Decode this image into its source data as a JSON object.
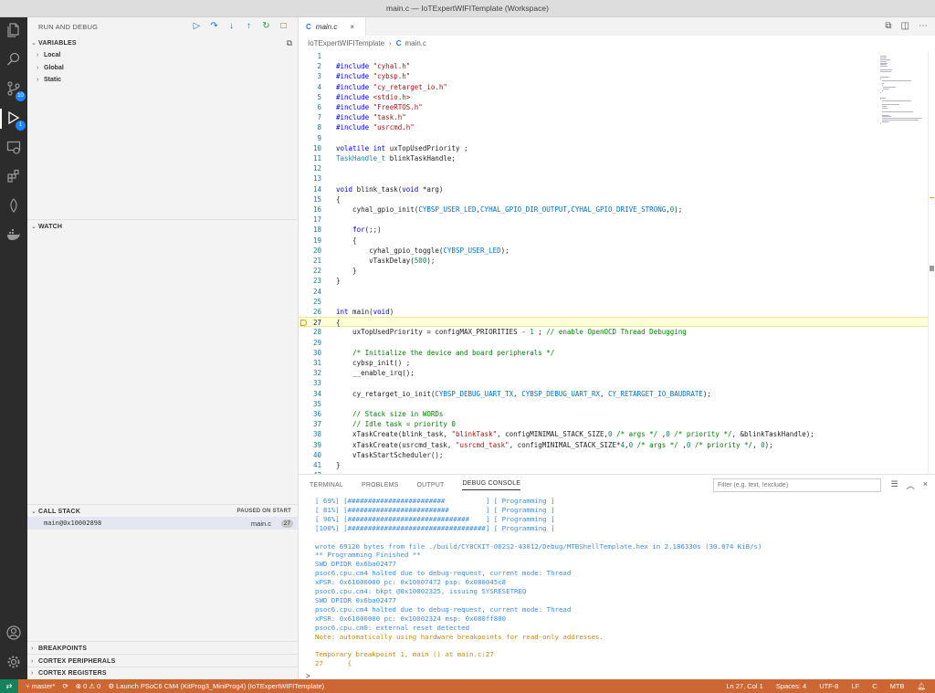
{
  "window": {
    "title": "main.c — IoTExpertWIFITemplate (Workspace)"
  },
  "activity_bar": {
    "items": [
      {
        "icon": "files-icon"
      },
      {
        "icon": "search-icon"
      },
      {
        "icon": "source-control-icon",
        "badge": "10"
      },
      {
        "icon": "run-debug-icon",
        "badge": "1"
      },
      {
        "icon": "remote-explorer-icon"
      },
      {
        "icon": "extensions-icon"
      },
      {
        "icon": "leaf-icon"
      },
      {
        "icon": "docker-icon"
      }
    ],
    "account_icon": "account-icon",
    "settings_icon": "gear-icon"
  },
  "sidebar": {
    "title": "RUN AND DEBUG",
    "toolbar": [
      "continue-icon",
      "step-over-icon",
      "step-into-icon",
      "step-out-icon",
      "restart-icon",
      "stop-icon"
    ],
    "variables": {
      "title": "VARIABLES",
      "items": [
        "Local",
        "Global",
        "Static"
      ]
    },
    "watch": {
      "title": "WATCH"
    },
    "call_stack": {
      "title": "CALL STACK",
      "status": "PAUSED ON START",
      "frame": "main@0x10002898",
      "file": "main.c",
      "line": "27"
    },
    "breakpoints": {
      "title": "BREAKPOINTS"
    },
    "cortex_peripherals": {
      "title": "CORTEX PERIPHERALS"
    },
    "cortex_registers": {
      "title": "CORTEX REGISTERS"
    }
  },
  "editor": {
    "tab": {
      "label": "main.c"
    },
    "breadcrumb": {
      "folder": "IoTExpertWIFITemplate",
      "file": "main.c"
    },
    "current_line": 27,
    "lines": [
      "",
      "#include \"cyhal.h\"",
      "#include \"cybsp.h\"",
      "#include \"cy_retarget_io.h\"",
      "#include <stdio.h>",
      "#include \"FreeRTOS.h\"",
      "#include \"task.h\"",
      "#include \"usrcmd.h\"",
      "",
      "volatile int uxTopUsedPriority ;",
      "TaskHandle_t blinkTaskHandle;",
      "",
      "",
      "void blink_task(void *arg)",
      "{",
      "    cyhal_gpio_init(CYBSP_USER_LED,CYHAL_GPIO_DIR_OUTPUT,CYHAL_GPIO_DRIVE_STRONG,0);",
      "",
      "    for(;;)",
      "    {",
      "        cyhal_gpio_toggle(CYBSP_USER_LED);",
      "        vTaskDelay(500);",
      "    }",
      "}",
      "",
      "",
      "int main(void)",
      "{",
      "    uxTopUsedPriority = configMAX_PRIORITIES - 1 ; // enable OpenOCD Thread Debugging",
      "",
      "    /* Initialize the device and board peripherals */",
      "    cybsp_init() ;",
      "    __enable_irq();",
      "",
      "    cy_retarget_io_init(CYBSP_DEBUG_UART_TX, CYBSP_DEBUG_UART_RX, CY_RETARGET_IO_BAUDRATE);",
      "",
      "    // Stack size in WORDs",
      "    // Idle task = priority 0",
      "    xTaskCreate(blink_task, \"blinkTask\", configMINIMAL_STACK_SIZE,0 /* args */ ,0 /* priority */, &blinkTaskHandle);",
      "    xTaskCreate(usrcmd_task, \"usrcmd_task\", configMINIMAL_STACK_SIZE*4,0 /* args */ ,0 /* priority */, 0);",
      "    vTaskStartScheduler();",
      "}",
      ""
    ]
  },
  "panel": {
    "tabs": [
      "TERMINAL",
      "PROBLEMS",
      "OUTPUT",
      "DEBUG CONSOLE"
    ],
    "active_tab": "DEBUG CONSOLE",
    "filter_placeholder": "Filter (e.g. text, !exclude)",
    "console": [
      {
        "text": "[ 69%] [########################          ] [ Programming ]",
        "color": "blue"
      },
      {
        "text": "[ 81%] [#########################         ] [ Programming ]",
        "color": "blue"
      },
      {
        "text": "[ 96%] [##############################    ] [ Programming ]",
        "color": "blue"
      },
      {
        "text": "[100%] [##################################] [ Programming ]",
        "color": "blue"
      },
      {
        "text": "",
        "color": "blue"
      },
      {
        "text": "wrote 69120 bytes from file ./build/CY8CKIT-062S2-43012/Debug/MTBShellTemplate.hex in 2.186330s (30.874 KiB/s)",
        "color": "blue"
      },
      {
        "text": "** Programming Finished **",
        "color": "blue"
      },
      {
        "text": "SWD DPIDR 0x6ba02477",
        "color": "blue"
      },
      {
        "text": "psoc6.cpu.cm4 halted due to debug-request, current mode: Thread",
        "color": "blue"
      },
      {
        "text": "xPSR: 0x61000000 pc: 0x10007472 psp: 0x080045c8",
        "color": "blue"
      },
      {
        "text": "psoc6.cpu.cm4: bkpt @0x10002325, issuing SYSRESETREQ",
        "color": "blue"
      },
      {
        "text": "SWD DPIDR 0x6ba02477",
        "color": "blue"
      },
      {
        "text": "psoc6.cpu.cm4 halted due to debug-request, current mode: Thread",
        "color": "blue"
      },
      {
        "text": "xPSR: 0x61000000 pc: 0x10002324 msp: 0x080ff800",
        "color": "blue"
      },
      {
        "text": "psoc6.cpu.cm0: external reset detected",
        "color": "blue"
      },
      {
        "text": "Note: automatically using hardware breakpoints for read-only addresses.",
        "color": "yellow"
      },
      {
        "text": "",
        "color": "blue"
      },
      {
        "text": "Temporary breakpoint 1, main () at main.c:27",
        "color": "yellow"
      },
      {
        "text": "27      {",
        "color": "yellow"
      }
    ],
    "prompt": ">"
  },
  "statusbar": {
    "branch": "master*",
    "sync_icon": "sync-icon",
    "problems": "⊗ 0 ⚠ 0",
    "launch": "Launch PSoC6 CM4 (KitProg3_MiniProg4) (IoTExpertWIFITemplate)",
    "position": "Ln 27, Col 1",
    "spaces": "Spaces: 4",
    "encoding": "UTF-8",
    "eol": "LF",
    "language": "C",
    "toolchain": "MTB"
  }
}
